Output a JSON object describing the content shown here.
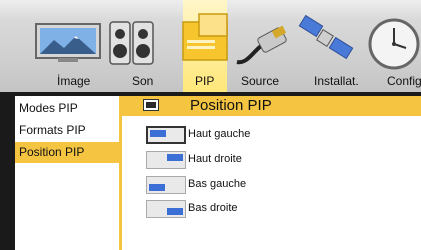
{
  "tabs": [
    {
      "label": "İmage",
      "icon": "landscape-icon"
    },
    {
      "label": "Son",
      "icon": "speaker-icon"
    },
    {
      "label": "PIP",
      "icon": "pip-icon"
    },
    {
      "label": "Source",
      "icon": "cable-plug-icon"
    },
    {
      "label": "Installat.",
      "icon": "satellite-icon"
    },
    {
      "label": "Config",
      "icon": "clock-icon"
    }
  ],
  "active_tab": "PIP",
  "menu": {
    "items": [
      {
        "label": "Modes PIP"
      },
      {
        "label": "Formats PIP"
      },
      {
        "label": "Position PIP"
      }
    ],
    "active_item": "Position PIP"
  },
  "panel": {
    "title": "Position PIP",
    "options": [
      {
        "label": "Haut gauche",
        "corner": "top-left",
        "selected": true
      },
      {
        "label": "Haut droite",
        "corner": "top-right",
        "selected": false
      },
      {
        "label": "Bas gauche",
        "corner": "bottom-left",
        "selected": false
      },
      {
        "label": "Bas droite",
        "corner": "bottom-right",
        "selected": false
      }
    ]
  },
  "colors": {
    "accent": "#f5c542",
    "pip_blue": "#3b6fd6"
  }
}
